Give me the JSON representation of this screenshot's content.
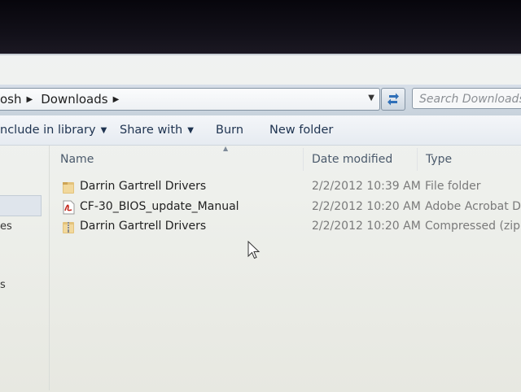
{
  "address_bar": {
    "crumbs": [
      "osh",
      "Downloads"
    ],
    "dropdown_icon": "chevron-down-icon",
    "refresh_icon": "refresh-icon"
  },
  "search": {
    "placeholder": "Search Downloads"
  },
  "toolbar": {
    "include_in_library": "nclude in library",
    "share_with": "Share with",
    "burn": "Burn",
    "new_folder": "New folder"
  },
  "nav": {
    "item_a": "es",
    "item_b": "s"
  },
  "columns": {
    "name": "Name",
    "date": "Date modified",
    "type": "Type"
  },
  "files": [
    {
      "name": "Darrin Gartrell Drivers",
      "date": "2/2/2012 10:39 AM",
      "type": "File folder",
      "icon": "folder-icon"
    },
    {
      "name": "CF-30_BIOS_update_Manual",
      "date": "2/2/2012 10:20 AM",
      "type": "Adobe Acrobat D...",
      "icon": "pdf-icon"
    },
    {
      "name": "Darrin Gartrell Drivers",
      "date": "2/2/2012 10:20 AM",
      "type": "Compressed (zipp...",
      "icon": "zip-folder-icon"
    }
  ],
  "colors": {
    "toolbar_text": "#1e3350",
    "header_text": "#4b5a6c",
    "meta_text": "#7a7a7a"
  }
}
